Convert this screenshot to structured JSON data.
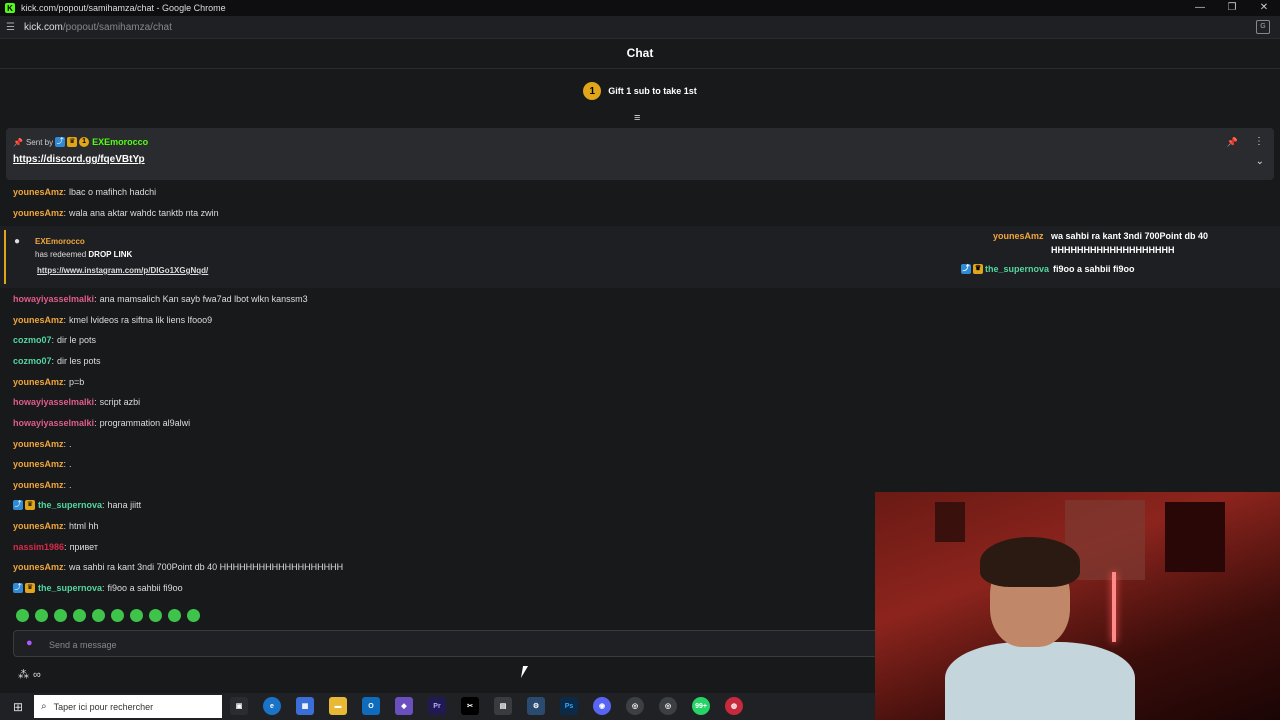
{
  "browser": {
    "window_title": "kick.com/popout/samihamza/chat - Google Chrome",
    "url_domain": "kick.com",
    "url_path": "/popout/samihamza/chat",
    "controls": {
      "minimize": "—",
      "restore": "❐",
      "close": "✕"
    }
  },
  "chat": {
    "header_title": "Chat",
    "gift": {
      "badge": "1",
      "text": "Gift 1 sub to take 1st"
    },
    "pinned": {
      "sent_by_label": "Sent by",
      "badge_sub": "1",
      "username": "EXEmorocco",
      "link": "https://discord.gg/fqeVBtYp"
    },
    "messages": [
      {
        "user": "younesAmz",
        "text": "lbac o mafihch hadchi"
      },
      {
        "user": "younesAmz",
        "text": "wala ana aktar wahdc tanktb nta zwin"
      },
      {
        "user": "howayiyasselmalki",
        "text": "ana mamsalich Kan sayb fwa7ad lbot wlkn kanssm3"
      },
      {
        "user": "younesAmz",
        "text": "kmel lvideos ra siftna lik liens lfooo9"
      },
      {
        "user": "cozmo07",
        "text": "dir le pots"
      },
      {
        "user": "cozmo07",
        "text": "dir les pots"
      },
      {
        "user": "younesAmz",
        "text": "p=b"
      },
      {
        "user": "howayiyasselmalki",
        "text": "script azbi"
      },
      {
        "user": "howayiyasselmalki",
        "text": "programmation al9alwi"
      },
      {
        "user": "younesAmz",
        "text": "."
      },
      {
        "user": "younesAmz",
        "text": "."
      },
      {
        "user": "younesAmz",
        "text": "."
      },
      {
        "user": "the_supernova",
        "text": "hana jiitt"
      },
      {
        "user": "younesAmz",
        "text": "html hh"
      },
      {
        "user": "nassim1986",
        "text": "привет"
      },
      {
        "user": "younesAmz",
        "text": "wa sahbi ra kant 3ndi 700Point db 40 HHHHHHHHHHHHHHHHHHH"
      },
      {
        "user": "the_supernova",
        "text": "fi9oo a sahbii fi9oo"
      }
    ],
    "redemption": {
      "user": "EXEmorocco",
      "text_prefix": "has redeemed",
      "reward": "DROP LINK",
      "link": "https://www.instagram.com/p/DIGo1XGgNqd/"
    },
    "overlay": [
      {
        "user": "younesAmz",
        "text": "wa sahbi ra kant 3ndi 700Point db 40",
        "text2": "HHHHHHHHHHHHHHHHHHH"
      },
      {
        "user": "the_supernova",
        "text": "fi9oo a sahbii fi9oo"
      }
    ],
    "input_placeholder": "Send a message",
    "points": "∞"
  },
  "taskbar": {
    "search_placeholder": "Taper ici pour rechercher",
    "apps": [
      "Task View",
      "Edge",
      "Store",
      "Explorer",
      "Outlook",
      "Photos",
      "Pr",
      "CapCut",
      "App",
      "App",
      "Ps",
      "Discord",
      "Chrome",
      "Chrome",
      "99+",
      "App"
    ],
    "notification_badge": "99+"
  }
}
